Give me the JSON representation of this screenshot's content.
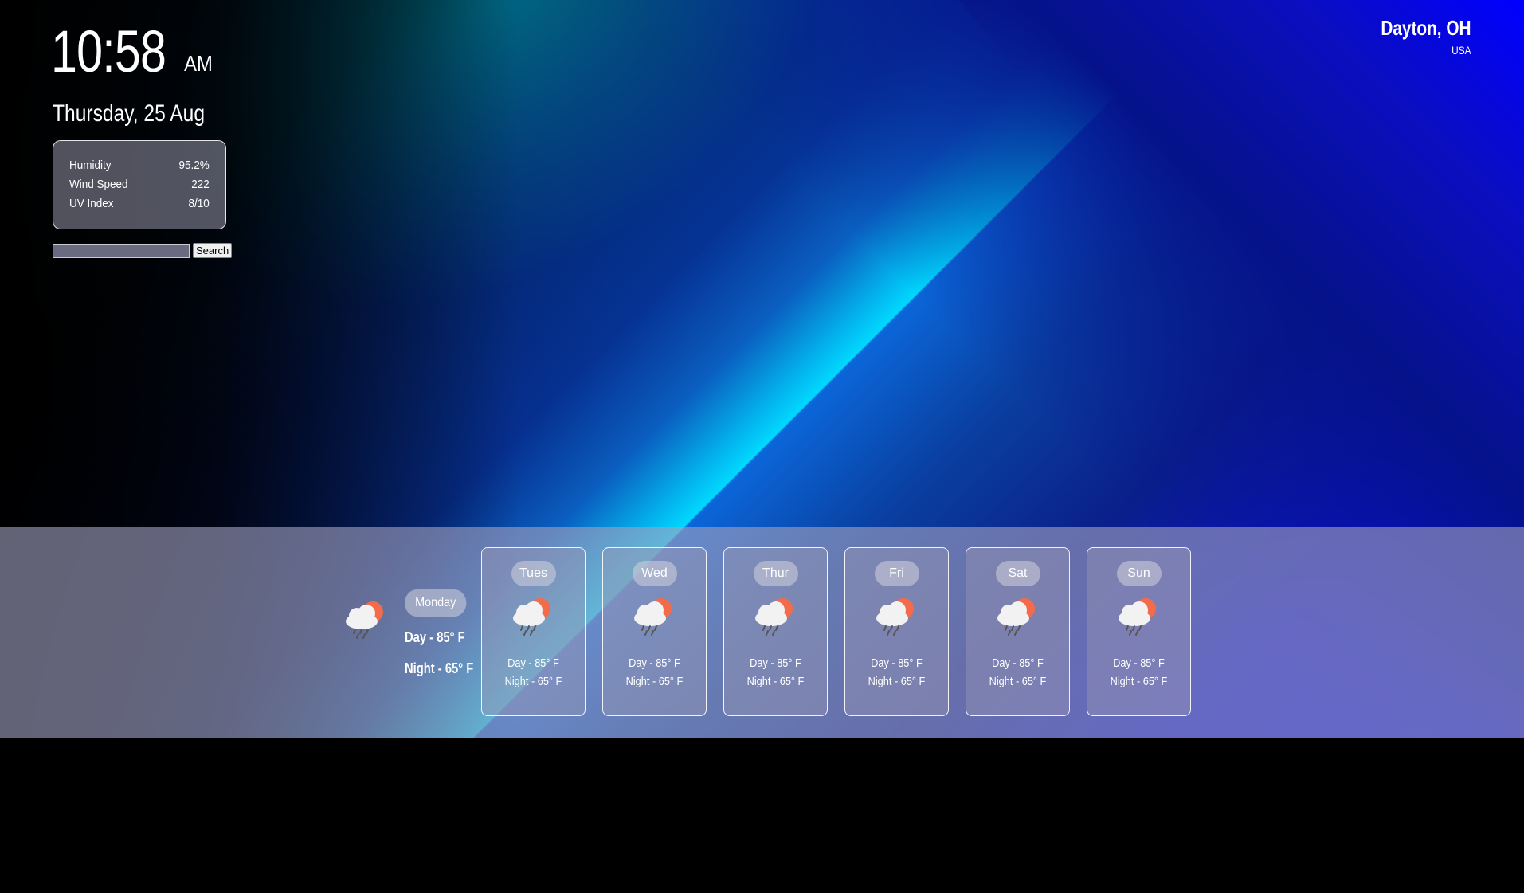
{
  "clock": {
    "time": "10:58",
    "ampm": "AM",
    "date": "Thursday, 25 Aug"
  },
  "location": {
    "city": "Dayton, OH",
    "country": "USA"
  },
  "stats": [
    {
      "label": "Humidity",
      "value": "95.2%"
    },
    {
      "label": "Wind Speed",
      "value": "222"
    },
    {
      "label": "UV Index",
      "value": "8/10"
    }
  ],
  "search": {
    "value": "",
    "button_label": "Search"
  },
  "today": {
    "day": "Monday",
    "day_temp": "Day - 85° F",
    "night_temp": "Night - 65° F",
    "icon": "rain-cloud-sun-icon"
  },
  "forecast": [
    {
      "day": "Tues",
      "day_temp": "Day - 85° F",
      "night_temp": "Night - 65° F",
      "icon": "rain-cloud-sun-icon"
    },
    {
      "day": "Wed",
      "day_temp": "Day - 85° F",
      "night_temp": "Night - 65° F",
      "icon": "rain-cloud-sun-icon"
    },
    {
      "day": "Thur",
      "day_temp": "Day - 85° F",
      "night_temp": "Night - 65° F",
      "icon": "rain-cloud-sun-icon"
    },
    {
      "day": "Fri",
      "day_temp": "Day - 85° F",
      "night_temp": "Night - 65° F",
      "icon": "rain-cloud-sun-icon"
    },
    {
      "day": "Sat",
      "day_temp": "Day - 85° F",
      "night_temp": "Night - 65° F",
      "icon": "rain-cloud-sun-icon"
    },
    {
      "day": "Sun",
      "day_temp": "Day - 85° F",
      "night_temp": "Night - 65° F",
      "icon": "rain-cloud-sun-icon"
    }
  ],
  "colors": {
    "sun": "#f26b4a",
    "cloud": "#f2f2f2",
    "rain": "#555555"
  }
}
